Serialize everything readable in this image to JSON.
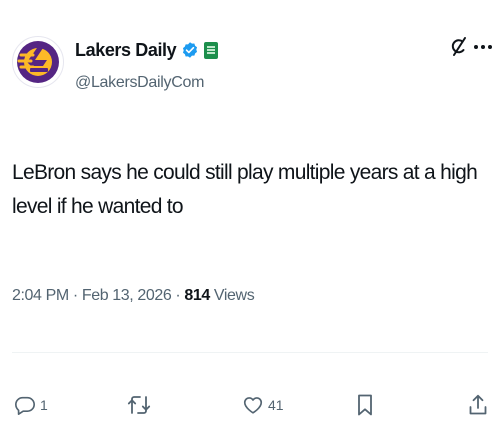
{
  "author": {
    "display_name": "Lakers Daily",
    "handle": "@LakersDailyCom",
    "verified_color": "#1d9bf0",
    "affiliate_badge_color": "#1c8f4c",
    "avatar_colors": [
      "#552583",
      "#fdb927"
    ]
  },
  "tweet": {
    "text": "LeBron says he could still play multiple years at a high level if he wanted to",
    "time": "2:04 PM",
    "separator": "·",
    "date": "Feb 13, 2026",
    "views_count": "814",
    "views_label": "Views"
  },
  "actions": {
    "reply_count": "1",
    "repost_count": "",
    "like_count": "41"
  },
  "icons": [
    "grok-icon",
    "more-icon",
    "reply-icon",
    "repost-icon",
    "like-icon",
    "bookmark-icon",
    "share-icon",
    "verified-icon"
  ]
}
